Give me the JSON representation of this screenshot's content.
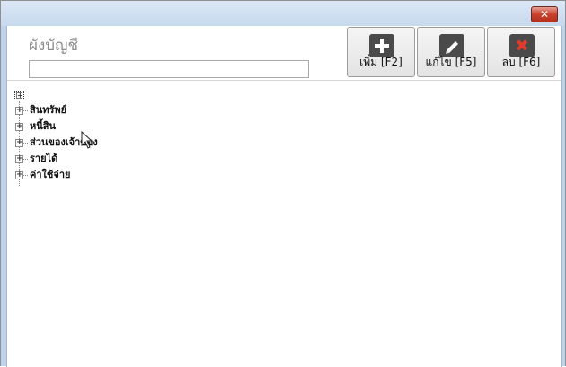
{
  "window": {
    "close_icon": "close-icon"
  },
  "header": {
    "title": "ผังบัญชี",
    "input_value": ""
  },
  "toolbar": {
    "add_label": "เพิ่ม [F2]",
    "edit_label": "แก้ไข [F5]",
    "delete_label": "ลบ [F6]"
  },
  "tree": {
    "root_expander": "+",
    "items": [
      {
        "label": "สินทรัพย์"
      },
      {
        "label": "หนี้สิน"
      },
      {
        "label": "ส่วนของเจ้าของ"
      },
      {
        "label": "รายได้"
      },
      {
        "label": "ค่าใช้จ่าย"
      }
    ]
  }
}
